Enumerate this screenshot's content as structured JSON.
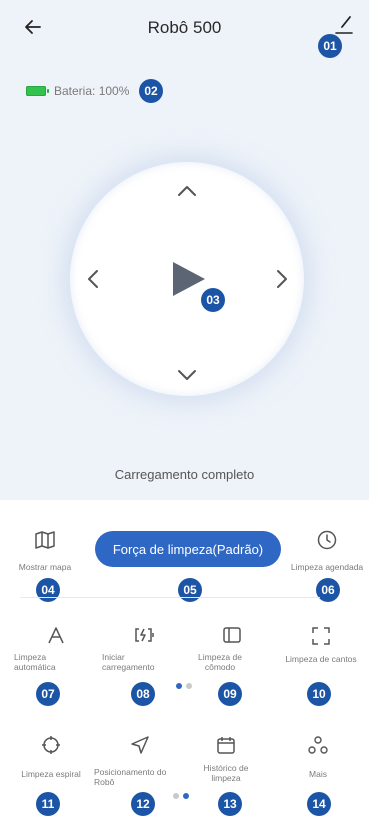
{
  "header": {
    "title": "Robô 500",
    "back_icon": "arrow-left-icon",
    "edit_icon": "pencil-icon"
  },
  "battery": {
    "label": "Bateria: 100%",
    "level": 1.0,
    "color": "#33c24d"
  },
  "control": {
    "status": "Carregamento completo"
  },
  "panel": {
    "show_map": "Mostrar mapa",
    "force_button": "Força de limpeza(Padrão)",
    "scheduled": "Limpeza agendada",
    "grid_row1": [
      "Limpeza automática",
      "Iniciar carregamento",
      "Limpeza de cômodo",
      "Limpeza de cantos"
    ],
    "grid_row2": [
      "Limpeza espiral",
      "Posicionamento do Robô",
      "Histórico de limpeza",
      "Mais"
    ]
  },
  "badges": [
    "01",
    "02",
    "03",
    "04",
    "05",
    "06",
    "07",
    "08",
    "09",
    "10",
    "11",
    "12",
    "13",
    "14"
  ],
  "colors": {
    "accent": "#2f68c4",
    "badge": "#1c55a5",
    "background": "#eef3f9"
  }
}
